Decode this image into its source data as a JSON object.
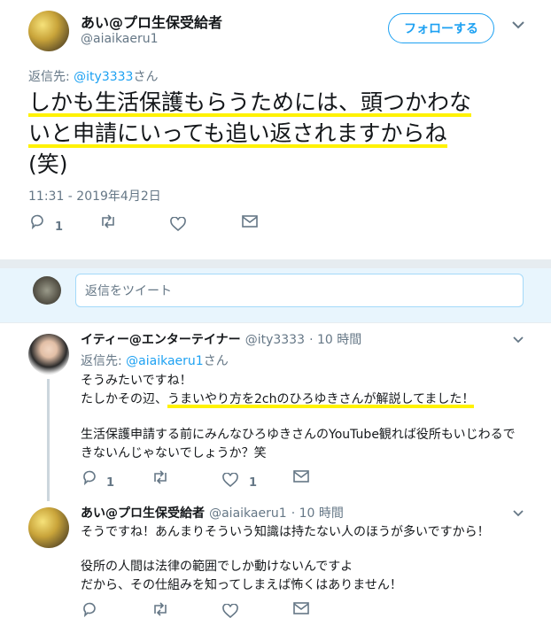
{
  "main_tweet": {
    "author_name": "あい@プロ生保受給者",
    "author_handle": "@aiaikaeru1",
    "follow_label": "フォローする",
    "reply_to_prefix": "返信先:",
    "reply_to_user": "@ity3333",
    "reply_to_suffix": "さん",
    "text_line1": "しかも生活保護もらうためには、頭つかわな",
    "text_line2": "いと申請にいっても追い返されますからね",
    "text_line3": "(笑)",
    "timestamp": "11:31 - 2019年4月2日",
    "reply_count": "1"
  },
  "reply_box": {
    "placeholder": "返信をツイート"
  },
  "replies": [
    {
      "author_name": "イティー@エンターテイナー",
      "author_handle": "@ity3333",
      "time": "· 10 時間",
      "reply_to_prefix": "返信先:",
      "reply_to_user": "@aiaikaeru1",
      "reply_to_suffix": "さん",
      "line1": "そうみたいですね！",
      "line2_pre": "たしかその辺、",
      "line2_hl": "うまいやり方を2chのひろゆきさんが解説してました！",
      "line3": "生活保護申請する前にみんなひろゆきさんのYouTube観れば役所もいじわるで",
      "line4": "きないんじゃないでしょうか？笑",
      "reply_count": "1",
      "like_count": "1"
    },
    {
      "author_name": "あい@プロ生保受給者",
      "author_handle": "@aiaikaeru1",
      "time": "· 10 時間",
      "line1": "そうですね！あんまりそういう知識は持たない人のほうが多いですから！",
      "line2": "役所の人間は法律の範囲でしか動けないんですよ",
      "line3": "だから、その仕組みを知ってしまえば怖くはありません！"
    }
  ],
  "icons": [
    "reply-icon",
    "retweet-icon",
    "like-icon",
    "message-icon",
    "chevron-down-icon"
  ],
  "colors": {
    "accent": "#1da1f2",
    "highlight": "#fff200",
    "band": "#e6ecf0"
  }
}
